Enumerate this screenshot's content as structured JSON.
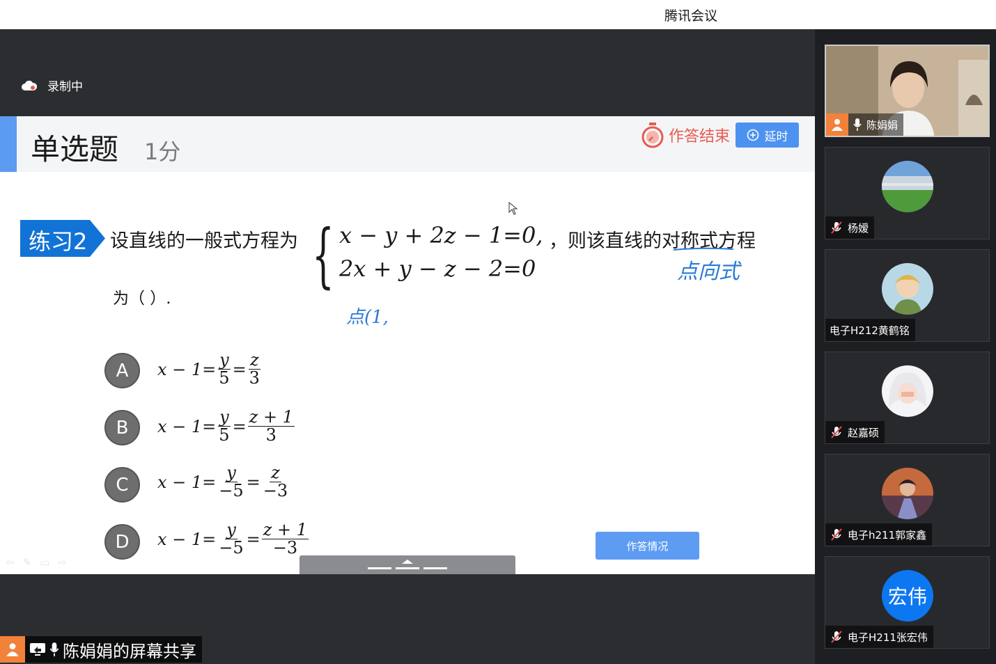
{
  "app": {
    "title": "腾讯会议"
  },
  "recording": {
    "label": "录制中"
  },
  "question": {
    "type_label": "单选题",
    "score_label": "1分",
    "timer_label": "作答结束",
    "extend_label": "延时",
    "practice_tag": "练习2",
    "stem_prefix": "设直线的一般式方程为",
    "equation_1": "x − y + 2z − 1=0,",
    "equation_2": "2x + y − z − 2=0",
    "stem_suffix": "，则该直线的对称式方程",
    "stem_end": "为（  ）.",
    "annotation_1": "点向式",
    "annotation_2": "点(1,",
    "options": [
      {
        "letter": "A",
        "lhs": "x − 1=",
        "f1_num": "y",
        "f1_den": "5",
        "eq": "=",
        "f2_num": "z",
        "f2_den": "3"
      },
      {
        "letter": "B",
        "lhs": "x − 1=",
        "f1_num": "y",
        "f1_den": "5",
        "eq": "=",
        "f2_num": "z + 1",
        "f2_den": "3"
      },
      {
        "letter": "C",
        "lhs": "x − 1=",
        "f1_num": "y",
        "f1_den": "−5",
        "eq": "=",
        "f2_num": "z",
        "f2_den": "−3"
      },
      {
        "letter": "D",
        "lhs": "x − 1=",
        "f1_num": "y",
        "f1_den": "−5",
        "eq": "=",
        "f2_num": "z + 1",
        "f2_den": "−3"
      }
    ],
    "answers_button": "作答情况"
  },
  "participants": [
    {
      "name": "陈娟娟",
      "video": true,
      "mic": "on"
    },
    {
      "name": "杨嫒",
      "video": false,
      "mic": "muted"
    },
    {
      "name": "电子H212黄鹤铭",
      "video": false,
      "mic": "none"
    },
    {
      "name": "赵嘉硕",
      "video": false,
      "mic": "muted"
    },
    {
      "name": "电子h211郭家鑫",
      "video": false,
      "mic": "muted"
    },
    {
      "name": "电子H211张宏伟",
      "video": false,
      "mic": "muted",
      "avatar_text": "宏伟"
    }
  ],
  "screen_share": {
    "label": "陈娟娟的屏幕共享"
  },
  "colors": {
    "accent": "#4d92f0",
    "timer_red": "#e85a4f",
    "handwriting": "#2a7ad6",
    "tag_blue": "#1273d6"
  }
}
